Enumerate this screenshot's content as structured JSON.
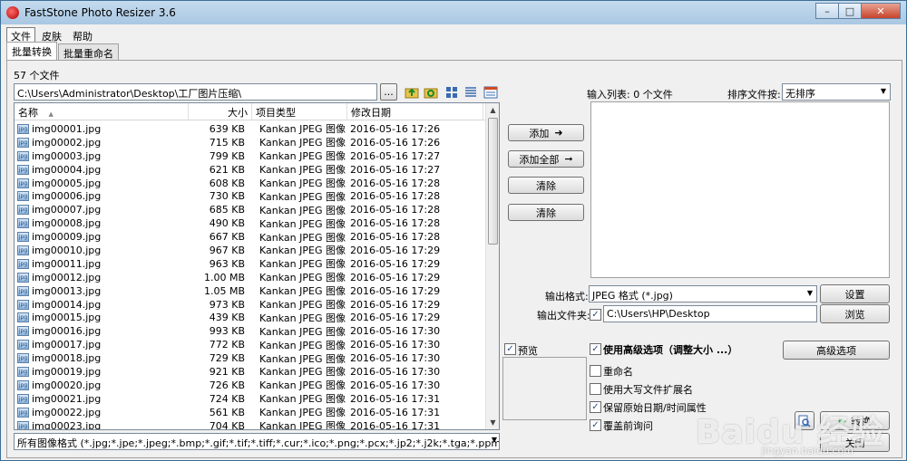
{
  "window": {
    "title": "FastStone Photo Resizer 3.6"
  },
  "menu": [
    "文件",
    "皮肤",
    "帮助"
  ],
  "tabs": [
    "批量转换",
    "批量重命名"
  ],
  "file_count": "57 个文件",
  "path": "C:\\Users\\Administrator\\Desktop\\工厂图片压缩\\",
  "browse_label": "...",
  "columns": {
    "name": "名称",
    "size": "大小",
    "type": "项目类型",
    "date": "修改日期"
  },
  "files": [
    {
      "name": "img00001.jpg",
      "size": "639 KB",
      "type": "Kankan JPEG 图像",
      "date": "2016-05-16 17:26"
    },
    {
      "name": "img00002.jpg",
      "size": "715 KB",
      "type": "Kankan JPEG 图像",
      "date": "2016-05-16 17:26"
    },
    {
      "name": "img00003.jpg",
      "size": "799 KB",
      "type": "Kankan JPEG 图像",
      "date": "2016-05-16 17:27"
    },
    {
      "name": "img00004.jpg",
      "size": "621 KB",
      "type": "Kankan JPEG 图像",
      "date": "2016-05-16 17:27"
    },
    {
      "name": "img00005.jpg",
      "size": "608 KB",
      "type": "Kankan JPEG 图像",
      "date": "2016-05-16 17:28"
    },
    {
      "name": "img00006.jpg",
      "size": "730 KB",
      "type": "Kankan JPEG 图像",
      "date": "2016-05-16 17:28"
    },
    {
      "name": "img00007.jpg",
      "size": "685 KB",
      "type": "Kankan JPEG 图像",
      "date": "2016-05-16 17:28"
    },
    {
      "name": "img00008.jpg",
      "size": "490 KB",
      "type": "Kankan JPEG 图像",
      "date": "2016-05-16 17:28"
    },
    {
      "name": "img00009.jpg",
      "size": "667 KB",
      "type": "Kankan JPEG 图像",
      "date": "2016-05-16 17:28"
    },
    {
      "name": "img00010.jpg",
      "size": "967 KB",
      "type": "Kankan JPEG 图像",
      "date": "2016-05-16 17:29"
    },
    {
      "name": "img00011.jpg",
      "size": "963 KB",
      "type": "Kankan JPEG 图像",
      "date": "2016-05-16 17:29"
    },
    {
      "name": "img00012.jpg",
      "size": "1.00 MB",
      "type": "Kankan JPEG 图像",
      "date": "2016-05-16 17:29"
    },
    {
      "name": "img00013.jpg",
      "size": "1.05 MB",
      "type": "Kankan JPEG 图像",
      "date": "2016-05-16 17:29"
    },
    {
      "name": "img00014.jpg",
      "size": "973 KB",
      "type": "Kankan JPEG 图像",
      "date": "2016-05-16 17:29"
    },
    {
      "name": "img00015.jpg",
      "size": "439 KB",
      "type": "Kankan JPEG 图像",
      "date": "2016-05-16 17:29"
    },
    {
      "name": "img00016.jpg",
      "size": "993 KB",
      "type": "Kankan JPEG 图像",
      "date": "2016-05-16 17:30"
    },
    {
      "name": "img00017.jpg",
      "size": "772 KB",
      "type": "Kankan JPEG 图像",
      "date": "2016-05-16 17:30"
    },
    {
      "name": "img00018.jpg",
      "size": "729 KB",
      "type": "Kankan JPEG 图像",
      "date": "2016-05-16 17:30"
    },
    {
      "name": "img00019.jpg",
      "size": "921 KB",
      "type": "Kankan JPEG 图像",
      "date": "2016-05-16 17:30"
    },
    {
      "name": "img00020.jpg",
      "size": "726 KB",
      "type": "Kankan JPEG 图像",
      "date": "2016-05-16 17:30"
    },
    {
      "name": "img00021.jpg",
      "size": "724 KB",
      "type": "Kankan JPEG 图像",
      "date": "2016-05-16 17:31"
    },
    {
      "name": "img00022.jpg",
      "size": "561 KB",
      "type": "Kankan JPEG 图像",
      "date": "2016-05-16 17:31"
    },
    {
      "name": "img00023.jpg",
      "size": "704 KB",
      "type": "Kankan JPEG 图像",
      "date": "2016-05-16 17:31"
    }
  ],
  "filter": "所有图像格式 (*.jpg;*.jpe;*.jpeg;*.bmp;*.gif;*.tif;*.tiff;*.cur;*.ico;*.png;*.pcx;*.jp2;*.j2k;*.tga;*.ppm;*.wmf;*.psd;*",
  "buttons": {
    "add": "添加",
    "add_all": "添加全部",
    "clear": "清除",
    "clear_all": "清除"
  },
  "input_list_label": "输入列表: 0 个文件",
  "sort_label": "排序文件按:",
  "sort_value": "无排序",
  "output_format_label": "输出格式:",
  "output_format_value": "JPEG 格式 (*.jpg)",
  "settings_label": "设置",
  "output_folder_label": "输出文件夹:",
  "output_folder_value": "C:\\Users\\HP\\Desktop",
  "browse2_label": "浏览",
  "preview_label": "预览",
  "advanced_use_label": "使用高级选项（调整大小 ...）",
  "advanced_btn_label": "高级选项",
  "rename_label": "重命名",
  "uppercase_label": "使用大写文件扩展名",
  "keep_date_label": "保留原始日期/时间属性",
  "overwrite_label": "覆盖前询问",
  "convert_label": "转换",
  "close_label": "关闭",
  "watermark": "Baidu 经验",
  "watermark_sub": "jingyan.baidu.com",
  "colors": {
    "title_bar": "#b7d1ea",
    "window_bg": "#f0f0f0",
    "close_btn": "#c7442b",
    "convert_icon": "#1a9a2a"
  }
}
